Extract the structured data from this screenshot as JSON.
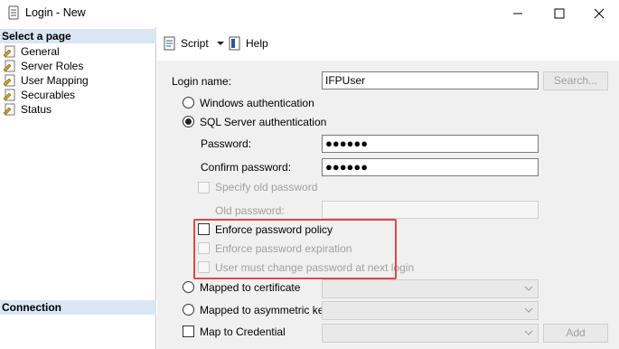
{
  "window": {
    "title": "Login - New",
    "app_icon": "database-icon",
    "controls": [
      "minimize-icon",
      "maximize-icon",
      "close-icon"
    ]
  },
  "sidebar": {
    "select_page_header": "Select a page",
    "items": [
      {
        "label": "General",
        "icon": "page-wrench-icon"
      },
      {
        "label": "Server Roles",
        "icon": "page-wrench-icon"
      },
      {
        "label": "User Mapping",
        "icon": "page-wrench-icon"
      },
      {
        "label": "Securables",
        "icon": "page-wrench-icon"
      },
      {
        "label": "Status",
        "icon": "page-wrench-icon"
      }
    ],
    "connection_header": "Connection"
  },
  "toolbar": {
    "script_label": "Script",
    "help_label": "Help"
  },
  "form": {
    "login_name_label": "Login name:",
    "login_name_value": "IFPUser",
    "search_button": "Search...",
    "windows_auth_label": "Windows authentication",
    "sql_auth_label": "SQL Server authentication",
    "auth_selected": "SQL Server authentication",
    "password_label": "Password:",
    "password_value": "●●●●●●",
    "confirm_password_label": "Confirm password:",
    "confirm_password_value": "●●●●●●",
    "specify_old_password_label": "Specify old password",
    "old_password_label": "Old password:",
    "enforce_policy_label": "Enforce password policy",
    "enforce_expiration_label": "Enforce password expiration",
    "must_change_label": "User must change password at next login",
    "mapped_certificate_label": "Mapped to certificate",
    "mapped_asymmetric_label": "Mapped to asymmetric key",
    "map_credential_label": "Map to Credential",
    "add_button": "Add"
  },
  "colors": {
    "section_header_bg": "#dae6f4",
    "content_bg": "#f0f0f0",
    "highlight_border": "#e0474c"
  }
}
